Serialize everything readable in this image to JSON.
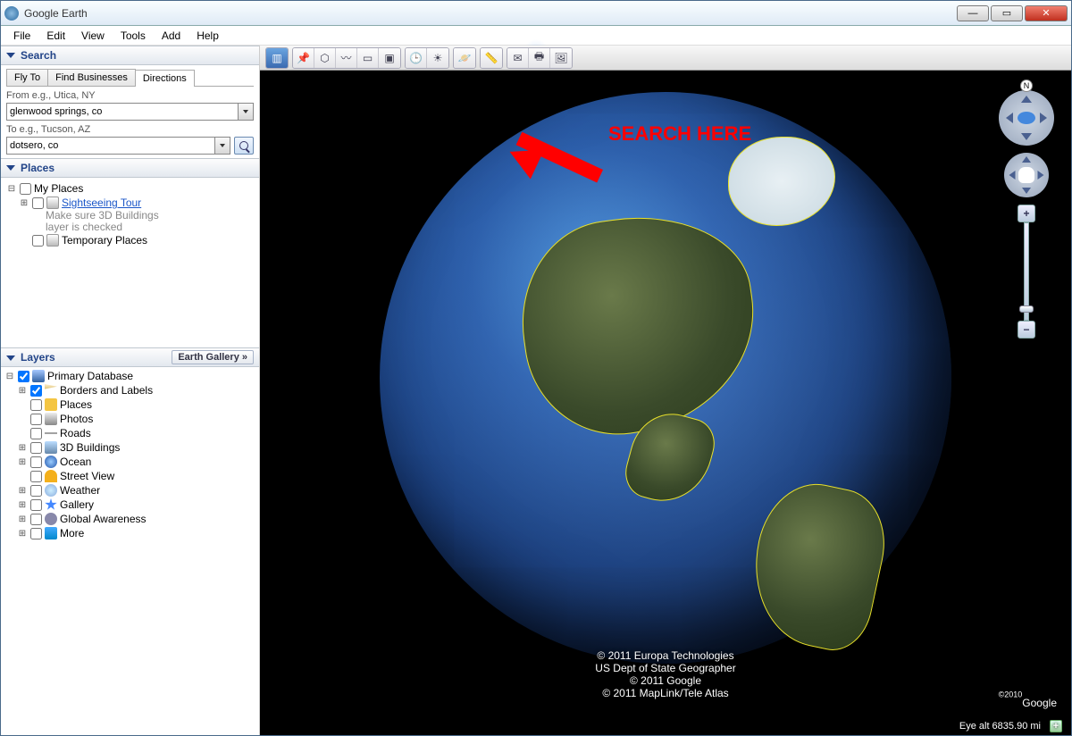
{
  "window": {
    "title": "Google Earth"
  },
  "menu": [
    "File",
    "Edit",
    "View",
    "Tools",
    "Add",
    "Help"
  ],
  "panels": {
    "search": {
      "title": "Search",
      "tabs": [
        "Fly To",
        "Find Businesses",
        "Directions"
      ],
      "active_tab": 2,
      "from_label": "From e.g., Utica, NY",
      "from_value": "glenwood springs, co",
      "to_label": "To e.g., Tucson, AZ",
      "to_value": "dotsero, co"
    },
    "places": {
      "title": "Places",
      "root": "My Places",
      "sightseeing": "Sightseeing Tour",
      "sightseeing_desc1": "Make sure 3D Buildings",
      "sightseeing_desc2": "layer is checked",
      "temp": "Temporary Places"
    },
    "layers": {
      "title": "Layers",
      "gallery_btn": "Earth Gallery »",
      "root": "Primary Database",
      "items": [
        {
          "label": "Borders and Labels",
          "checked": true,
          "icon": "flag",
          "expandable": true
        },
        {
          "label": "Places",
          "checked": false,
          "icon": "yellow"
        },
        {
          "label": "Photos",
          "checked": false,
          "icon": "img"
        },
        {
          "label": "Roads",
          "checked": false,
          "icon": "road"
        },
        {
          "label": "3D Buildings",
          "checked": false,
          "icon": "bldg",
          "expandable": true
        },
        {
          "label": "Ocean",
          "checked": false,
          "icon": "ocn",
          "expandable": true
        },
        {
          "label": "Street View",
          "checked": false,
          "icon": "man"
        },
        {
          "label": "Weather",
          "checked": false,
          "icon": "wx",
          "expandable": true
        },
        {
          "label": "Gallery",
          "checked": false,
          "icon": "star",
          "expandable": true
        },
        {
          "label": "Global Awareness",
          "checked": false,
          "icon": "gear",
          "expandable": true
        },
        {
          "label": "More",
          "checked": false,
          "icon": "more",
          "expandable": true
        }
      ]
    }
  },
  "annotation": "SEARCH HERE",
  "credits": {
    "l1": "© 2011 Europa Technologies",
    "l2": "US Dept of State Geographer",
    "l3": "© 2011 Google",
    "l4": "© 2011 MapLink/Tele Atlas"
  },
  "status": {
    "eye_alt": "Eye alt  6835.90 mi"
  },
  "logo": "Google",
  "logo_year": "©2010",
  "compass_n": "N"
}
